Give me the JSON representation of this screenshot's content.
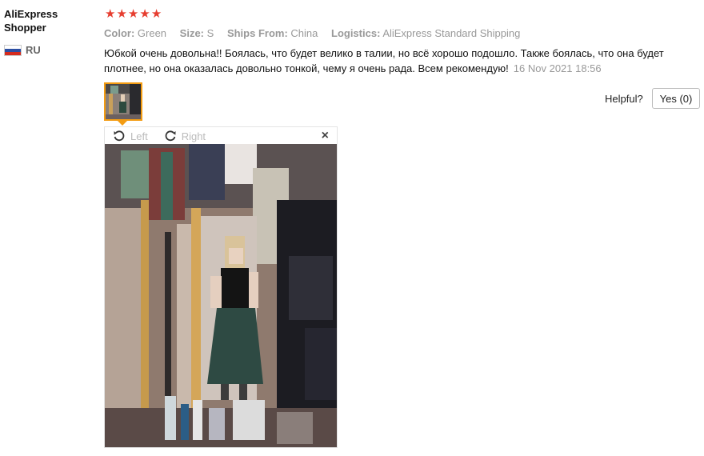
{
  "user": {
    "name": "AliExpress Shopper",
    "country": "RU",
    "flag_colors": [
      "#ffffff",
      "#2c4fa3",
      "#d52b1e"
    ]
  },
  "review": {
    "rating": 5,
    "rating_color": "#e63e30",
    "properties": [
      {
        "key": "Color:",
        "value": "Green"
      },
      {
        "key": "Size:",
        "value": "S"
      },
      {
        "key": "Ships From:",
        "value": "China"
      },
      {
        "key": "Logistics:",
        "value": "AliExpress Standard Shipping"
      }
    ],
    "text": "Юбкой очень довольна!! Боялась, что будет велико в талии, но всё хорошо подошло. Также боялась, что она будет плотнее, но она оказалась довольно тонкой, чему я очень рада. Всем рекомендую!",
    "date": "16 Nov 2021 18:56"
  },
  "helpful": {
    "label": "Helpful?",
    "yes_button": "Yes (0)"
  },
  "viewer": {
    "rotate_left": "Left",
    "rotate_right": "Right",
    "close_symbol": "×"
  },
  "icons": [
    "star-icon",
    "rotate-left-icon",
    "rotate-right-icon",
    "close-icon",
    "flag-icon"
  ]
}
